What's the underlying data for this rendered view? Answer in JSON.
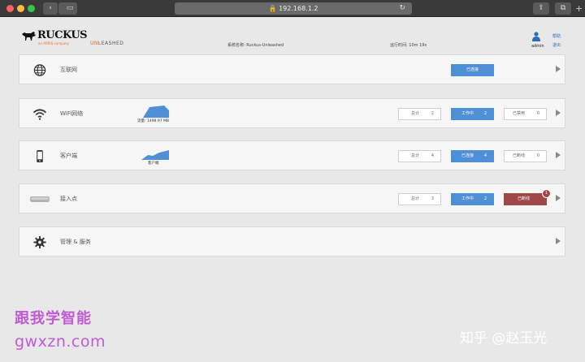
{
  "browser": {
    "url": "192.168.1.2",
    "plus": "+"
  },
  "header": {
    "brand": "RUCKUS",
    "brand_sub": "an ARRIS company",
    "unleashed_prefix": "UN",
    "unleashed_suffix": "LEASHED",
    "system_name": "系统名称: Ruckus-Unleashed",
    "uptime": "运行时间: 10m 19s",
    "user": "admin",
    "help": "帮助",
    "logout": "退出"
  },
  "panels": {
    "internet": {
      "title": "互联网",
      "status": "已连接"
    },
    "wifi": {
      "title": "WiFi网络",
      "traffic": "流量: 1498.97 MB",
      "total_label": "总计",
      "total": "2",
      "active_label": "工作中",
      "active": "2",
      "disabled_label": "已禁用",
      "disabled": "0"
    },
    "clients": {
      "title": "客户端",
      "spark_label": "客户端",
      "total_label": "总计",
      "total": "4",
      "connected_label": "已连接",
      "connected": "4",
      "disconnected_label": "已断线",
      "disconnected": "0"
    },
    "aps": {
      "title": "接入点",
      "total_label": "总计",
      "total": "3",
      "active_label": "工作中",
      "active": "2",
      "offline_label": "已断线",
      "badge": "1"
    },
    "admin": {
      "title": "管理 & 服务"
    }
  },
  "watermark": {
    "line1": "跟我学智能",
    "line2": "gwxzn.com",
    "credit": "知乎 @赵玉光"
  },
  "colors": {
    "accent_blue": "#4e8fd6",
    "alert_red": "#a04848",
    "brand_orange": "#f26a21"
  }
}
